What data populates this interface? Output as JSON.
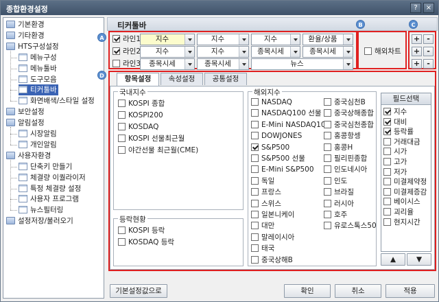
{
  "window": {
    "title": "종합환경설정",
    "minimize_glyph": "?",
    "close_glyph": "×"
  },
  "tree": [
    {
      "label": "기본환경",
      "type": "folder"
    },
    {
      "label": "기타환경",
      "type": "folder"
    },
    {
      "label": "HTS구성설정",
      "type": "folder"
    },
    {
      "label": "메뉴구성",
      "type": "page"
    },
    {
      "label": "메뉴툴바",
      "type": "page"
    },
    {
      "label": "도구모음",
      "type": "page"
    },
    {
      "label": "티커툴바",
      "type": "page",
      "selected": true
    },
    {
      "label": "화면배색/스타일 설정",
      "type": "page"
    },
    {
      "label": "보안설정",
      "type": "folder"
    },
    {
      "label": "알림설정",
      "type": "folder"
    },
    {
      "label": "시장알림",
      "type": "page"
    },
    {
      "label": "개인알림",
      "type": "page"
    },
    {
      "label": "사용자환경",
      "type": "folder"
    },
    {
      "label": "단축키 만들기",
      "type": "page"
    },
    {
      "label": "체결량 이퀄라이저",
      "type": "page"
    },
    {
      "label": "특정 체결량 설정",
      "type": "page"
    },
    {
      "label": "사용자 프로그램",
      "type": "page"
    },
    {
      "label": "뉴스필터링",
      "type": "page"
    },
    {
      "label": "설정저장/불러오기",
      "type": "folder"
    }
  ],
  "header": {
    "title": "티커툴바"
  },
  "markers": {
    "a": "A",
    "b": "B",
    "c": "C",
    "d": "D"
  },
  "lines": [
    {
      "label": "라인1",
      "checked": true,
      "dropdowns": [
        "지수",
        "지수",
        "지수",
        "환율/상품"
      ]
    },
    {
      "label": "라인2",
      "checked": true,
      "dropdowns": [
        "지수",
        "지수",
        "종목시세",
        "종목시세"
      ]
    },
    {
      "label": "라인3",
      "checked": false,
      "dropdowns": [
        "종목시세",
        "종목시세",
        "뉴스"
      ]
    }
  ],
  "overseas_chart": {
    "label": "해외차트",
    "checked": false
  },
  "plus": "+",
  "minus": "-",
  "tabs": [
    "항목설정",
    "속성설정",
    "공통설정"
  ],
  "domestic": {
    "title": "국내지수",
    "items": [
      "KOSPI 종합",
      "KOSPI200",
      "KOSDAQ",
      "KOSPI 선물최근월",
      "야간선물 최근월(CME)"
    ]
  },
  "rise": {
    "title": "등락현황",
    "items": [
      "KOSPI 등락",
      "KOSDAQ 등락"
    ]
  },
  "overseas": {
    "title": "해외지수",
    "col1": [
      {
        "t": "NASDAQ",
        "c": false
      },
      {
        "t": "NASDAQ100 선물",
        "c": false
      },
      {
        "t": "E-Mini NASDAQ100",
        "c": false
      },
      {
        "t": "DOWJONES",
        "c": false
      },
      {
        "t": "S&P500",
        "c": true
      },
      {
        "t": "S&P500 선물",
        "c": false
      },
      {
        "t": "E-Mini S&P500",
        "c": false
      },
      {
        "t": "독일",
        "c": false
      },
      {
        "t": "프랑스",
        "c": false
      },
      {
        "t": "스위스",
        "c": false
      },
      {
        "t": "일본니케이",
        "c": false
      },
      {
        "t": "대만",
        "c": false
      },
      {
        "t": "말레이시아",
        "c": false
      },
      {
        "t": "태국",
        "c": false
      },
      {
        "t": "중국상해B",
        "c": false
      }
    ],
    "col2": [
      {
        "t": "중국심천B",
        "c": false
      },
      {
        "t": "중국상해종합",
        "c": false
      },
      {
        "t": "중국심천종합",
        "c": false
      },
      {
        "t": "홍콩항셍",
        "c": false
      },
      {
        "t": "홍콩H",
        "c": false
      },
      {
        "t": "필리핀종합",
        "c": false
      },
      {
        "t": "인도네시아",
        "c": false
      },
      {
        "t": "인도",
        "c": false
      },
      {
        "t": "브라질",
        "c": false
      },
      {
        "t": "러시아",
        "c": false
      },
      {
        "t": "호주",
        "c": false
      },
      {
        "t": "유로스톡스50",
        "c": false
      }
    ]
  },
  "fields": {
    "title": "필드선택",
    "items": [
      {
        "t": "지수",
        "c": true
      },
      {
        "t": "대비",
        "c": true
      },
      {
        "t": "등락률",
        "c": true
      },
      {
        "t": "거래대금",
        "c": false
      },
      {
        "t": "시가",
        "c": false
      },
      {
        "t": "고가",
        "c": false
      },
      {
        "t": "저가",
        "c": false
      },
      {
        "t": "미결제약정",
        "c": false
      },
      {
        "t": "미결제증감",
        "c": false
      },
      {
        "t": "베이시스",
        "c": false
      },
      {
        "t": "괴리율",
        "c": false
      },
      {
        "t": "현지시간",
        "c": false
      }
    ],
    "up": "▲",
    "down": "▼"
  },
  "buttons": {
    "reset": "기본설정값으로",
    "ok": "확인",
    "cancel": "취소",
    "apply": "적용"
  }
}
